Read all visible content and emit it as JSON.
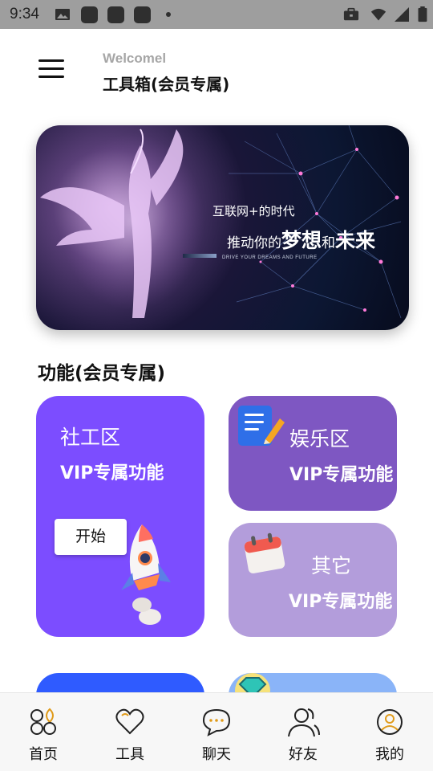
{
  "status_bar": {
    "time": "9:34"
  },
  "header": {
    "welcome": "Welcomel",
    "title": "工具箱(会员专属)"
  },
  "banner": {
    "line1": "互联网+的时代",
    "line2_prefix": "推动你的",
    "line2_dream": "梦想",
    "line2_and": "和",
    "line2_future": "未来",
    "subtitle": "DRIVE YOUR DREAMS AND FUTURE"
  },
  "section": {
    "title": "功能(会员专属)"
  },
  "cards": {
    "social": {
      "title": "社工区",
      "subtitle": "VIP专属功能",
      "button": "开始",
      "color": "#7c4dff"
    },
    "fun": {
      "title": "娱乐区",
      "subtitle": "VIP专属功能",
      "color": "#7e57c2"
    },
    "other": {
      "title": "其它",
      "subtitle": "VIP专属功能",
      "color": "#b39ddb"
    }
  },
  "bottom_nav": {
    "items": [
      {
        "label": "首页",
        "icon": "home-grid-icon"
      },
      {
        "label": "工具",
        "icon": "heart-icon"
      },
      {
        "label": "聊天",
        "icon": "chat-bubble-icon"
      },
      {
        "label": "好友",
        "icon": "friends-icon"
      },
      {
        "label": "我的",
        "icon": "profile-icon"
      }
    ]
  }
}
